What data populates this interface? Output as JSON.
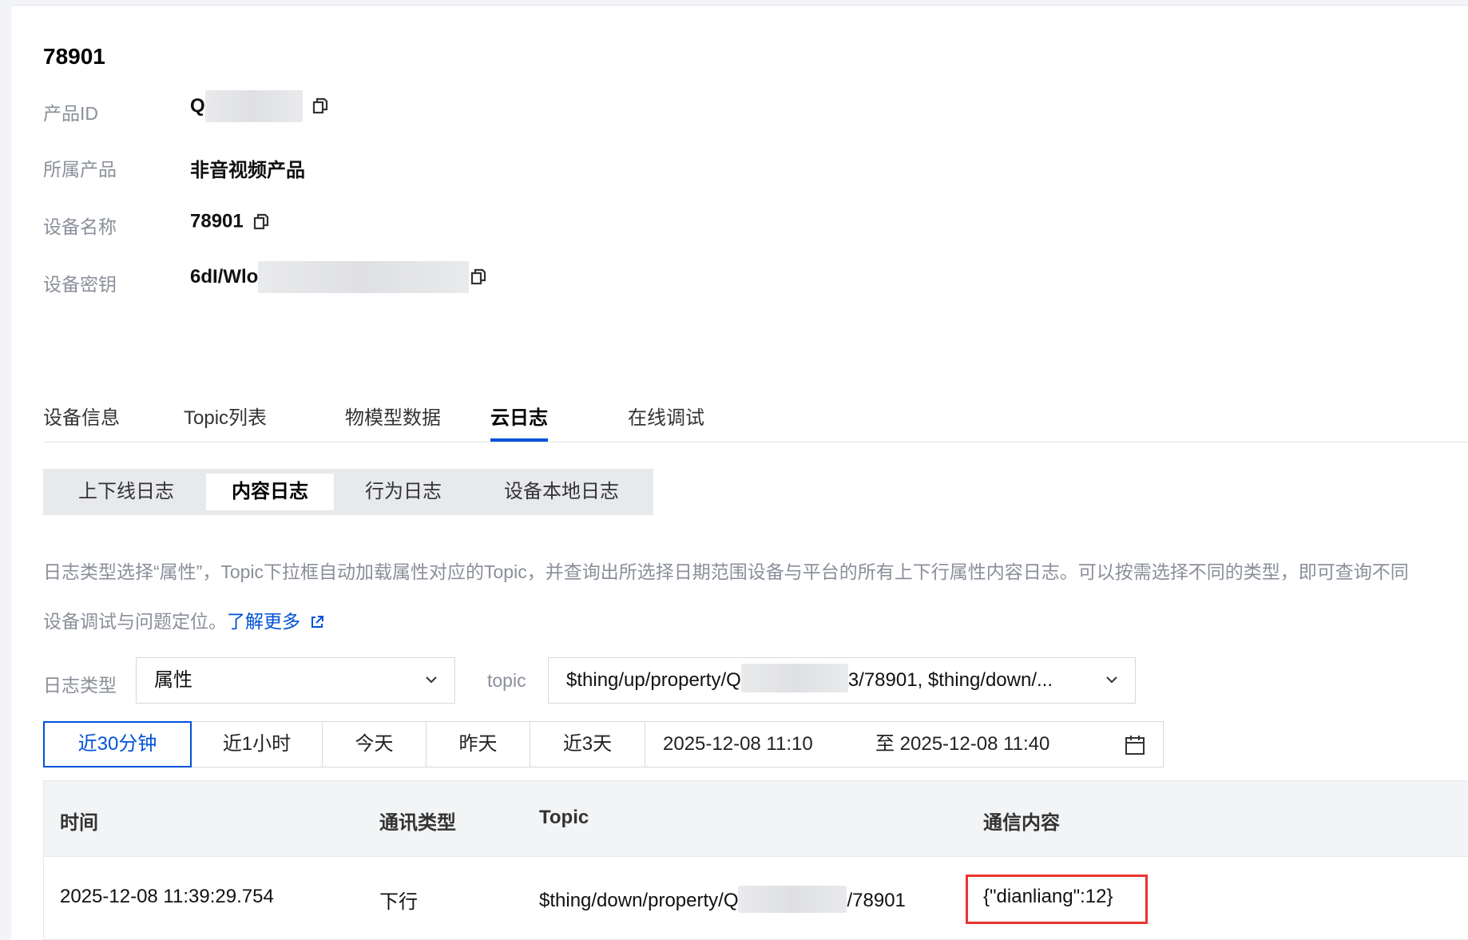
{
  "device": {
    "title": "78901",
    "fields": [
      {
        "label": "产品ID",
        "value": "Q"
      },
      {
        "label": "所属产品",
        "value": "非音视频产品"
      },
      {
        "label": "设备名称",
        "value": "78901"
      },
      {
        "label": "设备密钥",
        "value": "6dI/Wlo"
      }
    ]
  },
  "tabs": [
    {
      "label": "设备信息"
    },
    {
      "label": "Topic列表"
    },
    {
      "label": "物模型数据"
    },
    {
      "label": "云日志",
      "active": true
    },
    {
      "label": "在线调试"
    }
  ],
  "log_tabs": [
    {
      "label": "上下线日志"
    },
    {
      "label": "内容日志",
      "active": true
    },
    {
      "label": "行为日志"
    },
    {
      "label": "设备本地日志"
    }
  ],
  "description": {
    "line1": "日志类型选择“属性”，Topic下拉框自动加载属性对应的Topic，并查询出所选择日期范围设备与平台的所有上下行属性内容日志。可以按需选择不同的类型，即可查询不同",
    "line2": "设备调试与问题定位。",
    "link": "了解更多"
  },
  "filters": {
    "log_type_label": "日志类型",
    "log_type_value": "属性",
    "topic_label": "topic",
    "topic_value_prefix": "$thing/up/property/Q",
    "topic_value_suffix": "3/78901, $thing/down/..."
  },
  "time_range": {
    "buttons": [
      {
        "label": "近30分钟",
        "active": true
      },
      {
        "label": "近1小时"
      },
      {
        "label": "今天"
      },
      {
        "label": "昨天"
      },
      {
        "label": "近3天"
      }
    ],
    "start": "2025-12-08 11:10",
    "end": "至 2025-12-08 11:40"
  },
  "table": {
    "headers": [
      "时间",
      "通讯类型",
      "Topic",
      "通信内容"
    ],
    "rows": [
      {
        "time": "2025-12-08 11:39:29.754",
        "type": "下行",
        "topic_prefix": "$thing/down/property/Q",
        "topic_suffix": "/78901",
        "content": "{\"dianliang\":12}"
      }
    ]
  },
  "colors": {
    "accent": "#0052d9",
    "highlight": "#e8352f"
  }
}
